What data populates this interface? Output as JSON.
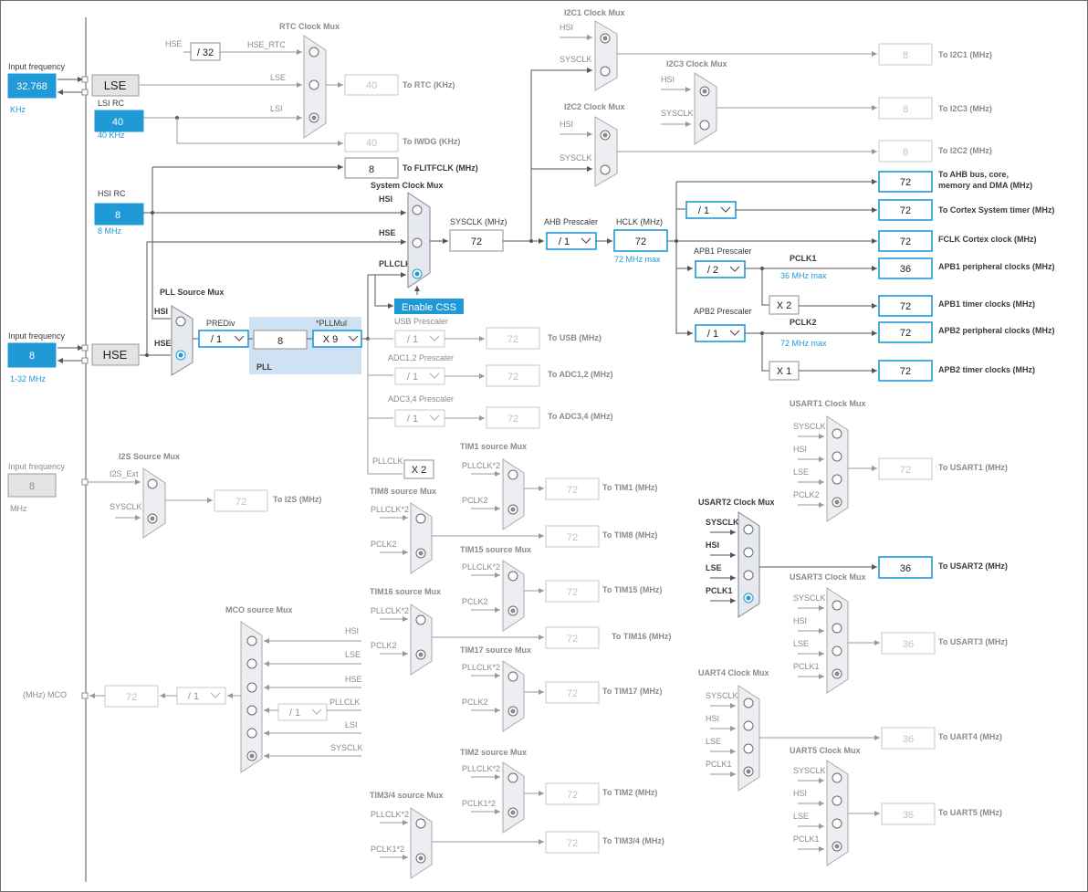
{
  "inputs": {
    "lse_freq_label": "Input frequency",
    "lse_freq_value": "32.768",
    "lse_freq_unit": "KHz",
    "lse_name": "LSE",
    "lsi_name": "LSI RC",
    "lsi_value": "40",
    "lsi_unit": "40 KHz",
    "hsi_name": "HSI RC",
    "hsi_value": "8",
    "hsi_unit": "8 MHz",
    "hse_freq_label": "Input frequency",
    "hse_freq_value": "8",
    "hse_freq_range": "1-32 MHz",
    "hse_name": "HSE",
    "i2s_freq_label": "Input frequency",
    "i2s_freq_value": "8",
    "i2s_freq_unit": "MHz"
  },
  "rtc": {
    "mux_title": "RTC Clock Mux",
    "hse_label": "HSE",
    "div": "/ 32",
    "hse_rtc": "HSE_RTC",
    "lse": "LSE",
    "lsi": "LSI",
    "rtc_value": "40",
    "rtc_label": "To RTC (KHz)",
    "iwdg_value": "40",
    "iwdg_label": "To IWDG (KHz)",
    "flit_value": "8",
    "flit_label": "To FLITFCLK (MHz)"
  },
  "sysclk_mux": {
    "title": "System Clock Mux",
    "hsi": "HSI",
    "hse": "HSE",
    "pllclk": "PLLCLK",
    "enable_css": "Enable CSS",
    "sysclk_label": "SYSCLK (MHz)",
    "sysclk_value": "72"
  },
  "pll": {
    "source_title": "PLL Source Mux",
    "hsi": "HSI",
    "hse": "HSE",
    "prediv_label": "PREDiv",
    "prediv_value": "/ 1",
    "pll_value": "8",
    "pllmul_label": "*PLLMul",
    "pllmul_value": "X 9",
    "pll_label": "PLL"
  },
  "ahb": {
    "prescaler_label": "AHB Prescaler",
    "prescaler_value": "/ 1",
    "hclk_label": "HCLK (MHz)",
    "hclk_value": "72",
    "hclk_max": "72 MHz max",
    "cortex_div": "/ 1"
  },
  "apb1": {
    "prescaler_label": "APB1 Prescaler",
    "prescaler_value": "/ 2",
    "pclk_label": "PCLK1",
    "pclk_max": "36 MHz max",
    "timer_mul": "X 2"
  },
  "apb2": {
    "prescaler_label": "APB2 Prescaler",
    "prescaler_value": "/ 1",
    "pclk_label": "PCLK2",
    "pclk_max": "72 MHz max",
    "timer_mul": "X 1"
  },
  "outputs": [
    {
      "value": "72",
      "label1": "To AHB bus, core,",
      "label2": "memory and DMA (MHz)"
    },
    {
      "value": "72",
      "label1": "To Cortex System timer (MHz)",
      "label2": ""
    },
    {
      "value": "72",
      "label1": "FCLK Cortex clock (MHz)",
      "label2": ""
    },
    {
      "value": "36",
      "label1": "APB1 peripheral clocks (MHz)",
      "label2": ""
    },
    {
      "value": "72",
      "label1": "APB1 timer clocks (MHz)",
      "label2": ""
    },
    {
      "value": "72",
      "label1": "APB2 peripheral clocks (MHz)",
      "label2": ""
    },
    {
      "value": "72",
      "label1": "APB2 timer clocks (MHz)",
      "label2": ""
    }
  ],
  "i2c": {
    "i2c1_title": "I2C1 Clock Mux",
    "i2c2_title": "I2C2 Clock Mux",
    "i2c3_title": "I2C3 Clock Mux",
    "hsi": "HSI",
    "sysclk": "SYSCLK",
    "i2c1_value": "8",
    "i2c1_label": "To I2C1 (MHz)",
    "i2c3_value": "8",
    "i2c3_label": "To I2C3 (MHz)",
    "i2c2_value": "8",
    "i2c2_label": "To I2C2 (MHz)"
  },
  "usb_adc": {
    "usb_prescaler": "USB Prescaler",
    "usb_div": "/ 1",
    "usb_value": "72",
    "usb_label": "To USB (MHz)",
    "adc12_prescaler": "ADC1,2 Prescaler",
    "adc12_div": "/ 1",
    "adc12_value": "72",
    "adc12_label": "To ADC1,2 (MHz)",
    "adc34_prescaler": "ADC3,4 Prescaler",
    "adc34_div": "/ 1",
    "adc34_value": "72",
    "adc34_label": "To ADC3,4 (MHz)",
    "pllclk": "PLLCLK",
    "x2": "X 2"
  },
  "i2s": {
    "title": "I2S Source Mux",
    "ext": "I2S_Ext",
    "sysclk": "SYSCLK",
    "value": "72",
    "label": "To I2S (MHz)"
  },
  "timers": {
    "pllclk2": "PLLCLK*2",
    "pclk2": "PCLK2",
    "pclk1_2": "PCLK1*2",
    "tim1_title": "TIM1 source Mux",
    "tim1_value": "72",
    "tim1_label": "To TIM1 (MHz)",
    "tim8_title": "TIM8 source Mux",
    "tim8_value": "72",
    "tim8_label": "To TIM8 (MHz)",
    "tim15_title": "TIM15 source Mux",
    "tim15_value": "72",
    "tim15_label": "To TIM15 (MHz)",
    "tim16_title": "TIM16 source Mux",
    "tim16_value": "72",
    "tim16_label": "To TIM16 (MHz)",
    "tim17_title": "TIM17 source Mux",
    "tim17_value": "72",
    "tim17_label": "To TIM17 (MHz)",
    "tim2_title": "TIM2 source Mux",
    "tim2_value": "72",
    "tim2_label": "To TIM2 (MHz)",
    "tim34_title": "TIM3/4 source Mux",
    "tim34_value": "72",
    "tim34_label": "To TIM3/4 (MHz)"
  },
  "mco": {
    "title": "MCO source Mux",
    "label": "(MHz) MCO",
    "value": "72",
    "div": "/ 1",
    "pll_div": "/ 1",
    "hsi": "HSI",
    "lse": "LSE",
    "hse": "HSE",
    "pllclk": "PLLCLK",
    "lsi": "LSI",
    "sysclk": "SYSCLK"
  },
  "uarts": {
    "sysclk": "SYSCLK",
    "hsi": "HSI",
    "lse": "LSE",
    "pclk2": "PCLK2",
    "pclk1": "PCLK1",
    "usart1_title": "USART1 Clock Mux",
    "usart1_value": "72",
    "usart1_label": "To USART1 (MHz)",
    "usart2_title": "USART2 Clock Mux",
    "usart2_value": "36",
    "usart2_label": "To USART2 (MHz)",
    "usart3_title": "USART3 Clock Mux",
    "usart3_value": "36",
    "usart3_label": "To USART3 (MHz)",
    "uart4_title": "UART4 Clock Mux",
    "uart4_value": "36",
    "uart4_label": "To UART4 (MHz)",
    "uart5_title": "UART5 Clock Mux",
    "uart5_value": "36",
    "uart5_label": "To UART5 (MHz)"
  }
}
